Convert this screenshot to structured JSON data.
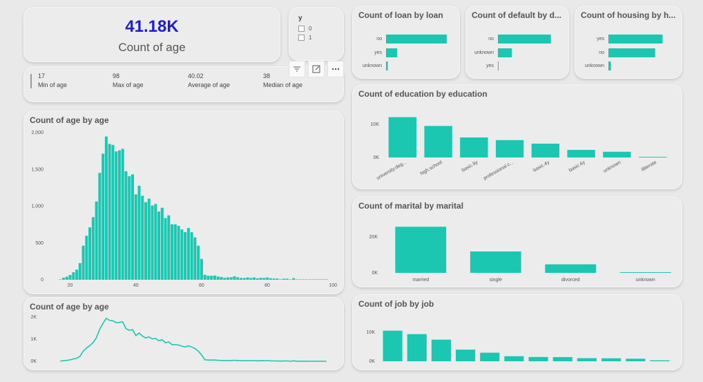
{
  "kpi": {
    "value": "41.18K",
    "label": "Count of age"
  },
  "stats": [
    {
      "value": "17",
      "label": "Min of age"
    },
    {
      "value": "98",
      "label": "Max of age"
    },
    {
      "value": "40.02",
      "label": "Average of age"
    },
    {
      "value": "38",
      "label": "Median of age"
    }
  ],
  "slicer": {
    "title": "y",
    "options": [
      "0",
      "1"
    ]
  },
  "visual_header": {
    "icons": [
      "filter-icon",
      "focus-mode-icon",
      "more-options-icon"
    ]
  },
  "colors": {
    "bar": "#1bc7b1",
    "kpi": "#1c1cd6"
  },
  "chart_data": [
    {
      "id": "loan",
      "type": "bar",
      "orientation": "horizontal",
      "title": "Count of loan by loan",
      "categories": [
        "no",
        "yes",
        "unknown"
      ],
      "values": [
        33950,
        6248,
        990
      ],
      "xlim": [
        0,
        34000
      ]
    },
    {
      "id": "default",
      "type": "bar",
      "orientation": "horizontal",
      "title": "Count of default by d...",
      "categories": [
        "no",
        "unknown",
        "yes"
      ],
      "values": [
        32588,
        8597,
        3
      ],
      "xlim": [
        0,
        34000
      ]
    },
    {
      "id": "housing",
      "type": "bar",
      "orientation": "horizontal",
      "title": "Count of housing by h...",
      "categories": [
        "yes",
        "no",
        "unknown"
      ],
      "values": [
        21576,
        18622,
        990
      ],
      "xlim": [
        0,
        22000
      ]
    },
    {
      "id": "education",
      "type": "bar",
      "title": "Count of education by education",
      "categories": [
        "university.deg...",
        "high.school",
        "basic.9y",
        "professional.c...",
        "basic.4y",
        "basic.6y",
        "unknown",
        "illiterate"
      ],
      "values": [
        12168,
        9515,
        6045,
        5243,
        4176,
        2292,
        1731,
        18
      ],
      "yticks": [
        "0K",
        "10K"
      ],
      "ylim": [
        0,
        15000
      ]
    },
    {
      "id": "marital",
      "type": "bar",
      "title": "Count of marital by marital",
      "categories": [
        "married",
        "single",
        "divorced",
        "unknown"
      ],
      "values": [
        24928,
        11568,
        4612,
        80
      ],
      "yticks": [
        "0K",
        "20K"
      ],
      "ylim": [
        0,
        28000
      ]
    },
    {
      "id": "job",
      "type": "bar",
      "title": "Count of job by job",
      "categories": [
        "",
        "",
        "",
        "",
        "",
        "",
        "",
        "",
        "",
        "",
        "",
        ""
      ],
      "values": [
        10422,
        9254,
        7366,
        3969,
        2924,
        1720,
        1456,
        1421,
        1060,
        1014,
        875,
        330
      ],
      "yticks": [
        "0K",
        "10K"
      ],
      "ylim": [
        0,
        12000
      ]
    },
    {
      "id": "age-hist",
      "type": "bar",
      "title": "Count of age by age",
      "x": [
        17,
        18,
        19,
        20,
        21,
        22,
        23,
        24,
        25,
        26,
        27,
        28,
        29,
        30,
        31,
        32,
        33,
        34,
        35,
        36,
        37,
        38,
        39,
        40,
        41,
        42,
        43,
        44,
        45,
        46,
        47,
        48,
        49,
        50,
        51,
        52,
        53,
        54,
        55,
        56,
        57,
        58,
        59,
        60,
        61,
        62,
        63,
        64,
        65,
        66,
        67,
        68,
        69,
        70,
        71,
        72,
        73,
        74,
        75,
        76,
        77,
        78,
        79,
        80,
        81,
        82,
        83,
        84,
        85,
        86,
        87,
        88,
        89,
        90,
        91,
        92,
        93,
        94,
        95,
        96,
        97,
        98
      ],
      "values": [
        5,
        28,
        42,
        65,
        102,
        137,
        226,
        463,
        598,
        712,
        851,
        1064,
        1453,
        1714,
        1947,
        1846,
        1833,
        1745,
        1759,
        1780,
        1475,
        1407,
        1432,
        1161,
        1278,
        1142,
        1055,
        1103,
        1010,
        1030,
        928,
        979,
        839,
        875,
        754,
        754,
        733,
        684,
        648,
        704,
        646,
        576,
        463,
        283,
        68,
        55,
        55,
        57,
        44,
        38,
        26,
        33,
        34,
        47,
        34,
        24,
        24,
        32,
        24,
        32,
        20,
        27,
        25,
        31,
        20,
        17,
        17,
        7,
        15,
        15,
        1,
        22,
        2,
        2,
        2,
        2,
        1,
        2,
        1,
        3,
        1,
        1
      ],
      "xticks": [
        20,
        40,
        60,
        80,
        100
      ],
      "yticks": [
        "0",
        "500",
        "1,000",
        "1,500",
        "2,000"
      ],
      "xlim": [
        14,
        101
      ],
      "ylim": [
        0,
        2000
      ]
    },
    {
      "id": "age-line",
      "type": "line",
      "title": "Count of age by age",
      "x": [
        17,
        18,
        19,
        20,
        21,
        22,
        23,
        24,
        25,
        26,
        27,
        28,
        29,
        30,
        31,
        32,
        33,
        34,
        35,
        36,
        37,
        38,
        39,
        40,
        41,
        42,
        43,
        44,
        45,
        46,
        47,
        48,
        49,
        50,
        51,
        52,
        53,
        54,
        55,
        56,
        57,
        58,
        59,
        60,
        61,
        62,
        63,
        64,
        65,
        66,
        67,
        68,
        69,
        70,
        71,
        72,
        73,
        74,
        75,
        76,
        77,
        78,
        79,
        80,
        81,
        82,
        83,
        84,
        85,
        86,
        87,
        88,
        89,
        90,
        91,
        92,
        93,
        94,
        95,
        96,
        97,
        98
      ],
      "values": [
        5,
        28,
        42,
        65,
        102,
        137,
        226,
        463,
        598,
        712,
        851,
        1064,
        1453,
        1714,
        1947,
        1846,
        1833,
        1745,
        1759,
        1780,
        1475,
        1407,
        1432,
        1161,
        1278,
        1142,
        1055,
        1103,
        1010,
        1030,
        928,
        979,
        839,
        875,
        754,
        754,
        733,
        684,
        648,
        704,
        646,
        576,
        463,
        283,
        68,
        55,
        55,
        57,
        44,
        38,
        26,
        33,
        34,
        47,
        34,
        24,
        24,
        32,
        24,
        32,
        20,
        27,
        25,
        31,
        20,
        17,
        17,
        7,
        15,
        15,
        1,
        22,
        2,
        2,
        2,
        2,
        1,
        2,
        1,
        3,
        1,
        1
      ],
      "yticks": [
        "0K",
        "1K",
        "2K"
      ],
      "xlim": [
        14,
        101
      ],
      "ylim": [
        0,
        2000
      ]
    }
  ]
}
